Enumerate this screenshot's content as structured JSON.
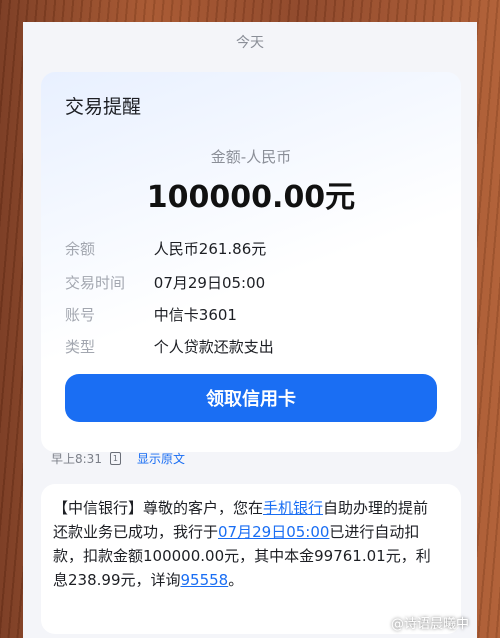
{
  "header": {
    "date": "今天"
  },
  "card": {
    "title": "交易提醒",
    "amount_label": "金额-人民币",
    "amount": "100000.00元",
    "rows": [
      {
        "key": "余额",
        "value": "人民币261.86元"
      },
      {
        "key": "交易时间",
        "value": "07月29日05:00"
      },
      {
        "key": "账号",
        "value": "中信卡3601"
      },
      {
        "key": "类型",
        "value": "个人贷款还款支出"
      }
    ],
    "cta_label": "领取信用卡"
  },
  "meta": {
    "time": "早上8:31",
    "sim": "1",
    "show_original": "显示原文"
  },
  "message": {
    "p1": "【中信银行】尊敬的客户，您在",
    "link1": "手机银行",
    "p2": "自助办理的提前还款业务已成功，我行于",
    "link2": "07月29日05:00",
    "p3": "已进行自动扣款，扣款金额100000.00元，其中本金99761.01元，利息238.99元，详询",
    "link3": "95558",
    "p4": "。"
  },
  "watermark": {
    "text": "@诗语晨曦中"
  },
  "colors": {
    "accent": "#1a6ef3",
    "background": "#f4f5f9"
  }
}
